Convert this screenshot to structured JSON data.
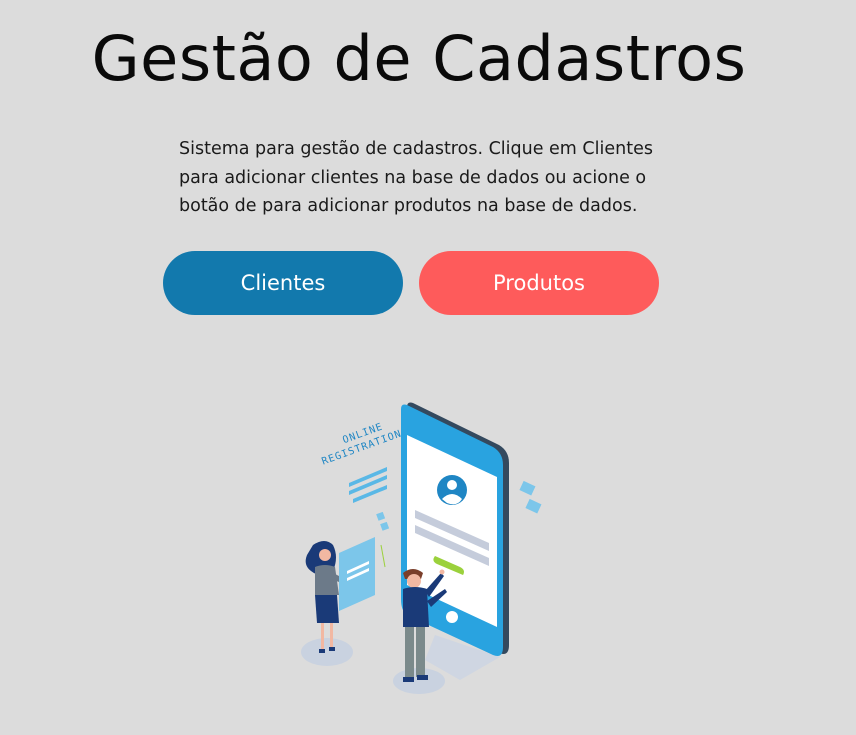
{
  "header": {
    "title": "Gestão de Cadastros"
  },
  "intro": {
    "description": "Sistema para gestão de cadastros. Clique em Clientes para adicionar clientes na base de dados ou acione o botão de para adicionar produtos na base de dados."
  },
  "actions": {
    "clientes_label": "Clientes",
    "produtos_label": "Produtos"
  },
  "illustration": {
    "text_line1": "ONLINE",
    "text_line2": "REGISTRATION"
  },
  "colors": {
    "background": "#dcdcdc",
    "clientes_button": "#1279ad",
    "produtos_button": "#fe5b5b",
    "phone_screen": "#29a3e0"
  }
}
